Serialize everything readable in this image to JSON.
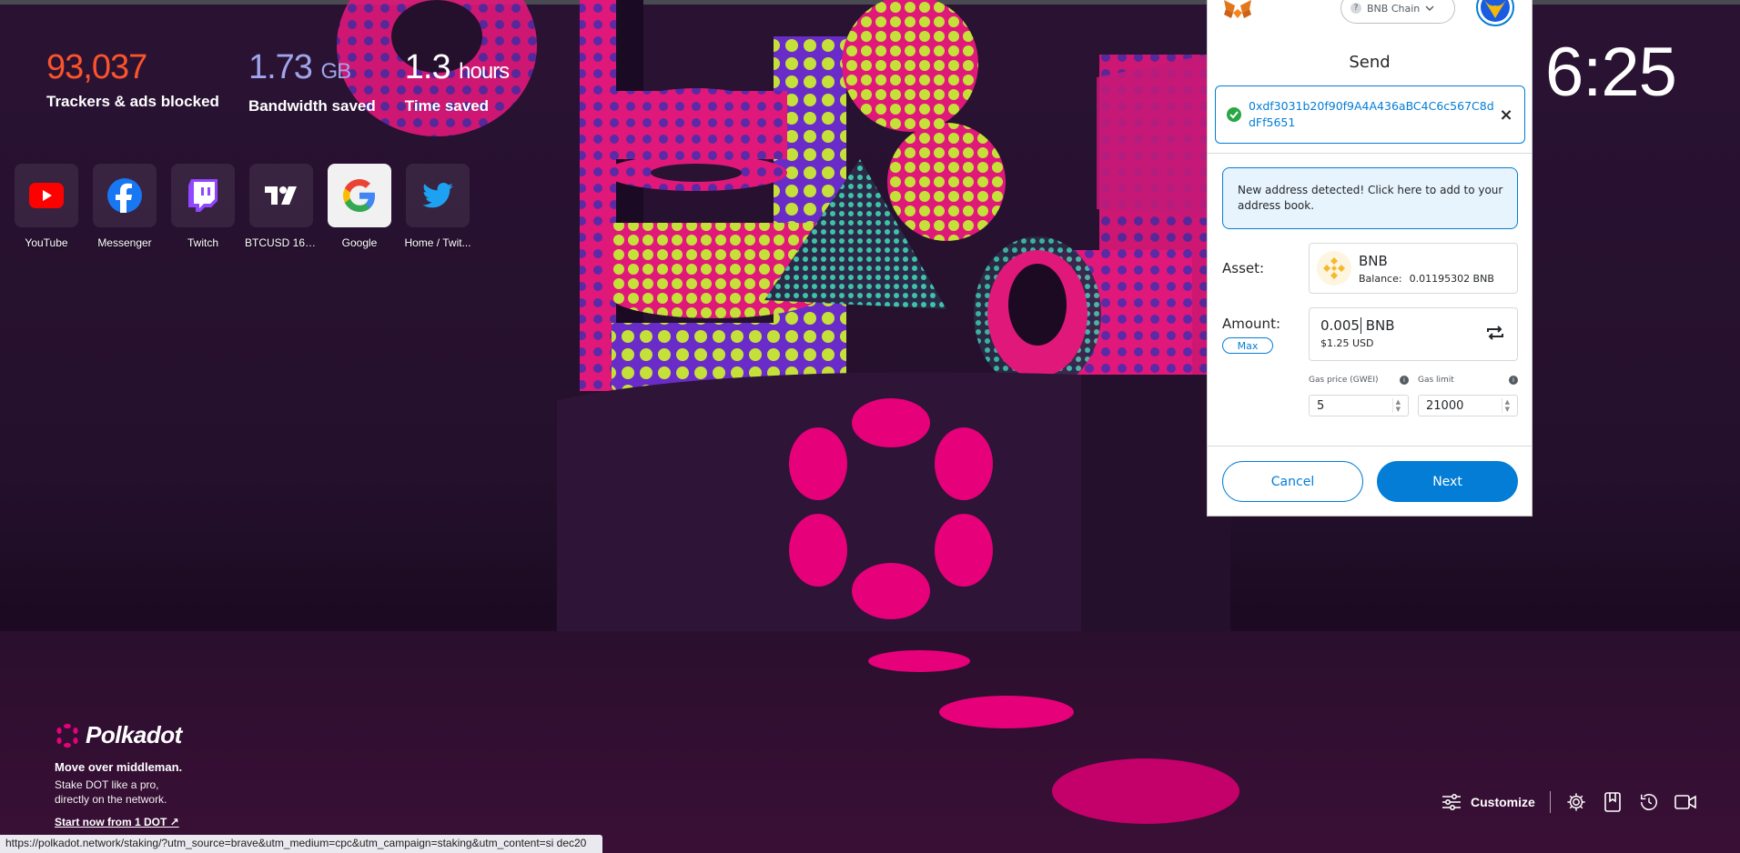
{
  "stats": {
    "trackers": {
      "value": "93,037",
      "label": "Trackers & ads blocked"
    },
    "bandwidth": {
      "value": "1.73",
      "unit": "GB",
      "label": "Bandwidth saved"
    },
    "time": {
      "value": "1.3",
      "unit": "hours",
      "label": "Time saved"
    }
  },
  "top_sites": [
    {
      "name": "YouTube",
      "icon": "youtube-icon"
    },
    {
      "name": "Messenger",
      "icon": "facebook-icon"
    },
    {
      "name": "Twitch",
      "icon": "twitch-icon"
    },
    {
      "name": "BTCUSD 168...",
      "icon": "tradingview-icon"
    },
    {
      "name": "Google",
      "icon": "google-icon"
    },
    {
      "name": "Home / Twit...",
      "icon": "twitter-icon"
    }
  ],
  "clock": "6:25",
  "ad": {
    "brand": "Polkadot",
    "headline": "Move over middleman.",
    "body_line1": "Stake DOT like a pro,",
    "body_line2": "directly on the network.",
    "cta": "Start now from 1 DOT ↗"
  },
  "toolbar": {
    "customize_label": "Customize",
    "icons": [
      "sliders-icon",
      "gear-icon",
      "bookmark-icon",
      "history-icon",
      "video-icon"
    ]
  },
  "status_url": "https://polkadot.network/staking/?utm_source=brave&utm_medium=cpc&utm_campaign=staking&utm_content=si dec20",
  "metamask": {
    "network": "BNB Chain",
    "title": "Send",
    "recipient": "0xdf3031b20f90f9A4A436aBC4C6c567C8ddFf5651",
    "notice": "New address detected! Click here to add to your address book.",
    "asset_label": "Asset:",
    "asset_name": "BNB",
    "balance_label": "Balance:",
    "balance_value": "0.01195302 BNB",
    "amount_label": "Amount:",
    "amount_value": "0.005",
    "amount_unit": "BNB",
    "amount_usd": "$1.25 USD",
    "max_label": "Max",
    "gas_price_label": "Gas price (GWEI)",
    "gas_price_value": "5",
    "gas_limit_label": "Gas limit",
    "gas_limit_value": "21000",
    "cancel_label": "Cancel",
    "next_label": "Next",
    "accent": "#037dd6"
  },
  "colors": {
    "trackers": "#fb542b",
    "bandwidth": "#a0a5eb",
    "polkadot_pink": "#e6007a"
  }
}
